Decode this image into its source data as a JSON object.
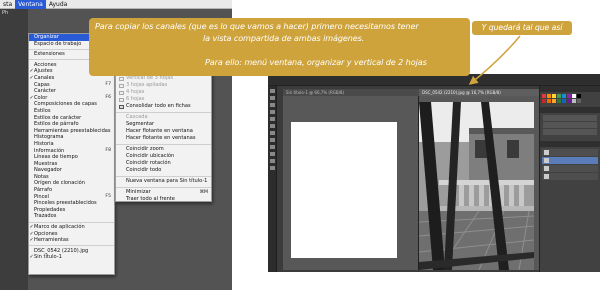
{
  "left_screenshot": {
    "menubar": [
      "sta",
      "Ventana",
      "Ayuda"
    ],
    "app_tab": "Ph",
    "ventana_menu": [
      {
        "label": "Organizar",
        "highlighted": true,
        "submenu": true
      },
      {
        "label": "Espacio de trabajo",
        "submenu": true
      },
      {
        "sep": true
      },
      {
        "label": "Extensiones",
        "submenu": true
      },
      {
        "sep": true
      },
      {
        "label": "Acciones",
        "shortcut": "⌥F9"
      },
      {
        "label": "Ajustes",
        "checked": true
      },
      {
        "label": "Canales",
        "checked": true
      },
      {
        "label": "Capas",
        "shortcut": "F7"
      },
      {
        "label": "Carácter"
      },
      {
        "label": "Color",
        "checked": true,
        "shortcut": "F6"
      },
      {
        "label": "Composiciones de capas"
      },
      {
        "label": "Estilos"
      },
      {
        "label": "Estilos de carácter"
      },
      {
        "label": "Estilos de párrafo"
      },
      {
        "label": "Herramientas preestablecidas"
      },
      {
        "label": "Histograma"
      },
      {
        "label": "Historia"
      },
      {
        "label": "Información",
        "shortcut": "F8"
      },
      {
        "label": "Líneas de tiempo"
      },
      {
        "label": "Muestras"
      },
      {
        "label": "Navegador"
      },
      {
        "label": "Notas"
      },
      {
        "label": "Orígen de clonación"
      },
      {
        "label": "Párrafo"
      },
      {
        "label": "Pincel",
        "shortcut": "F5"
      },
      {
        "label": "Pinceles preestablecidos"
      },
      {
        "label": "Propiedades"
      },
      {
        "label": "Trazados"
      },
      {
        "sep": true
      },
      {
        "label": "Marco de aplicación",
        "checked": true
      },
      {
        "label": "Opciones",
        "checked": true
      },
      {
        "label": "Herramientas",
        "checked": true
      },
      {
        "sep": true
      },
      {
        "label": "DSC_0542 (2210).jpg"
      },
      {
        "label": "Sin título-1",
        "checked": true
      }
    ],
    "organizar_submenu": [
      {
        "label": "Segmentar todo en vertical",
        "icon": true
      },
      {
        "label": "Segmentar todo en horizontal",
        "icon": true
      },
      {
        "label": "Horizontal de 2 hojas",
        "icon": true
      },
      {
        "label": "Vertical de 2 hojas",
        "icon": true,
        "highlighted": true
      },
      {
        "label": "Horizontal de 3 hojas",
        "icon": true,
        "disabled": true
      },
      {
        "label": "Vertical de 3 hojas",
        "icon": true,
        "disabled": true
      },
      {
        "label": "3 hojas apiladas",
        "icon": true,
        "disabled": true
      },
      {
        "label": "4 hojas",
        "icon": true,
        "disabled": true
      },
      {
        "label": "6 hojas",
        "icon": true,
        "disabled": true
      },
      {
        "label": "Consolidar todo en fichas",
        "icon": true
      },
      {
        "sep": true
      },
      {
        "label": "Cascada",
        "disabled": true
      },
      {
        "label": "Segmentar"
      },
      {
        "label": "Hacer flotante en ventana"
      },
      {
        "label": "Hacer flotante en ventanas"
      },
      {
        "sep": true
      },
      {
        "label": "Coincidir zoom"
      },
      {
        "label": "Coincidir ubicación"
      },
      {
        "label": "Coincidir rotación"
      },
      {
        "label": "Coincidir todo"
      },
      {
        "sep": true
      },
      {
        "label": "Nueva ventana para Sin título-1"
      },
      {
        "sep": true
      },
      {
        "label": "Minimizar",
        "shortcut": "⌘M"
      },
      {
        "label": "Traer todo al frente"
      }
    ]
  },
  "annotations": {
    "main_line1": "Para copiar los canales (que es lo que vamos a hacer) primero necesitamos tener",
    "main_line2": "la vista compartida de ambas imágenes.",
    "main_line3": "Para ello: menú ventana, organizar y vertical de 2 hojas",
    "side": "Y quedará tal que así",
    "accent_color": "#cfa33c"
  },
  "right_screenshot": {
    "tab_left": "Sin título-1 @ 66,7% (RGB/8)",
    "tab_right": "DSC_0542 (2210).jpg @ 16,7% (RGB/8)"
  }
}
